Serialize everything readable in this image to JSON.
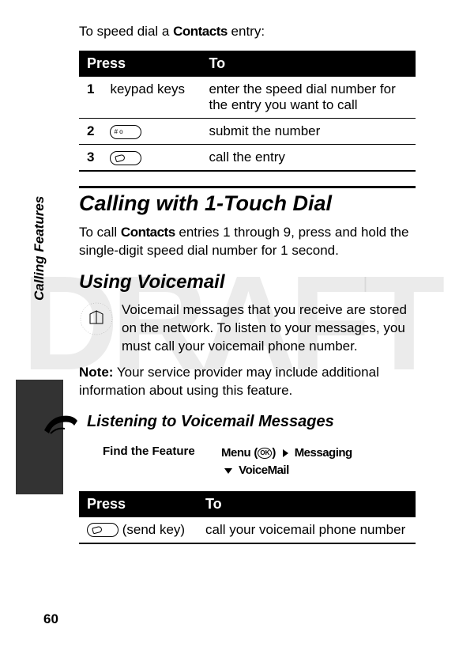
{
  "watermark": "DRAFT",
  "sideLabel": "Calling Features",
  "intro": {
    "prefix": "To speed dial a ",
    "bold": "Contacts",
    "suffix": " entry:"
  },
  "table1": {
    "headers": [
      "Press",
      "To"
    ],
    "rows": [
      {
        "n": "1",
        "press": "keypad keys",
        "to": "enter the speed dial number for the entry you want to call"
      },
      {
        "n": "2",
        "press_icon": "hash-key-icon",
        "to": "submit the number"
      },
      {
        "n": "3",
        "press_icon": "send-key-icon",
        "to": "call the entry"
      }
    ]
  },
  "h1": "Calling with 1-Touch Dial",
  "para1": {
    "prefix": "To call ",
    "bold": "Contacts",
    "suffix": " entries 1 through 9, press and hold the single-digit speed dial number for 1 second."
  },
  "h2": "Using Voicemail",
  "vm_para": "Voicemail messages that you receive are stored on the network. To listen to your messages, you must call your voicemail phone number.",
  "note": {
    "label": "Note:",
    "text": " Your service provider may include additional information about using this feature."
  },
  "h3": "Listening to Voicemail Messages",
  "findFeature": {
    "label": "Find the Feature",
    "menu": "Menu",
    "item1": "Messaging",
    "item2": "VoiceMail"
  },
  "table2": {
    "headers": [
      "Press",
      "To"
    ],
    "rows": [
      {
        "press_icon": "send-key-icon",
        "press_text": " (send key)",
        "to": "call your voicemail phone number"
      }
    ]
  },
  "pageNumber": "60"
}
